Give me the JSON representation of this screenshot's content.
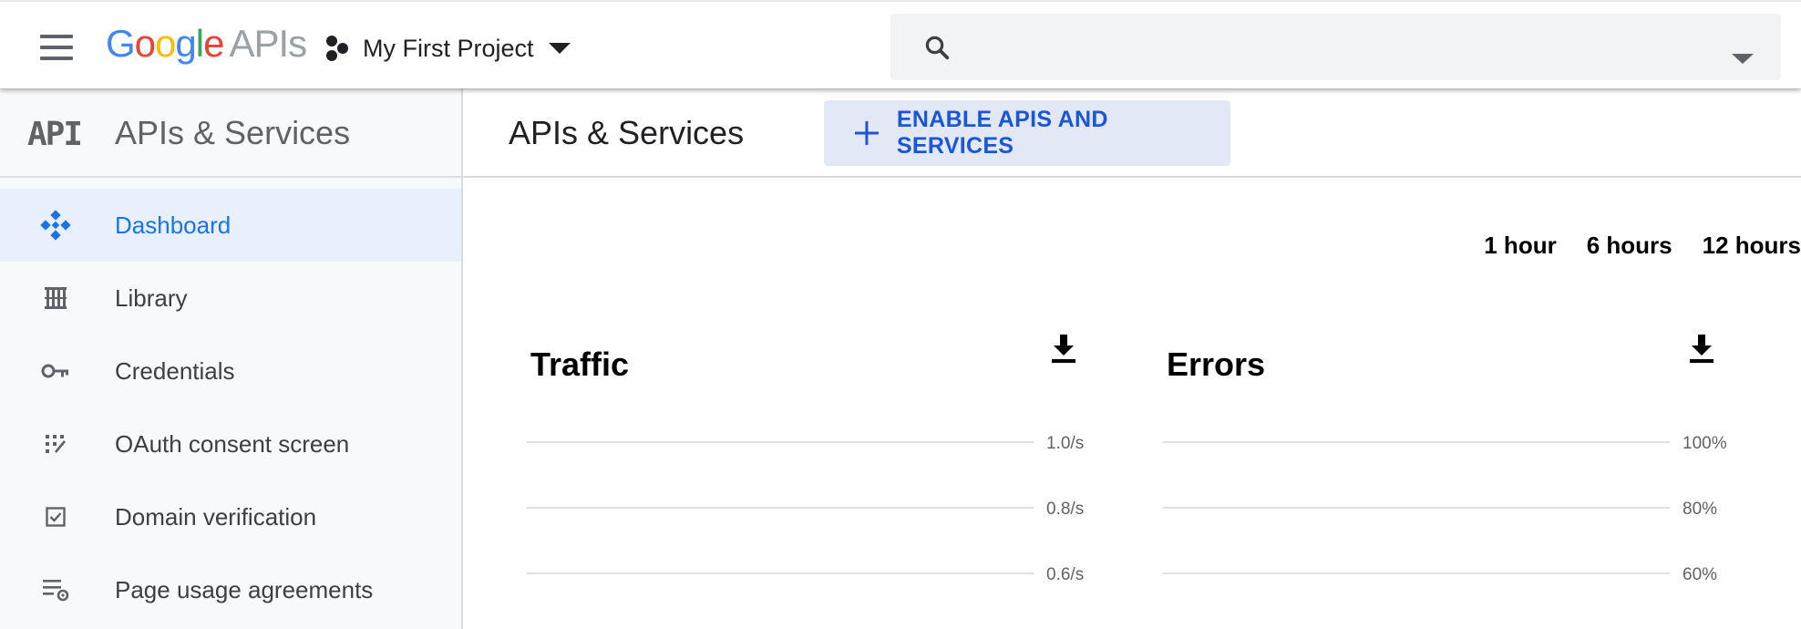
{
  "header": {
    "logo": {
      "google": [
        "G",
        "o",
        "o",
        "g",
        "l",
        "e"
      ],
      "suffix": "APIs",
      "colors": [
        "#4285F4",
        "#EA4335",
        "#FBBC05",
        "#4285F4",
        "#34A853",
        "#EA4335"
      ]
    },
    "project_name": "My First Project",
    "search": {
      "placeholder": "",
      "value": ""
    },
    "icons": {
      "menu": "hamburger-menu-icon",
      "project": "project-hub-icon",
      "search": "search-icon",
      "expand": "chevron-down-icon"
    }
  },
  "sidebar": {
    "logo_text": "API",
    "title": "APIs & Services",
    "items": [
      {
        "label": "Dashboard",
        "icon": "dashboard-icon",
        "active": true
      },
      {
        "label": "Library",
        "icon": "library-icon",
        "active": false
      },
      {
        "label": "Credentials",
        "icon": "key-icon",
        "active": false
      },
      {
        "label": "OAuth consent screen",
        "icon": "oauth-icon",
        "active": false
      },
      {
        "label": "Domain verification",
        "icon": "checkbox-icon",
        "active": false
      },
      {
        "label": "Page usage agreements",
        "icon": "settings-list-icon",
        "active": false
      }
    ]
  },
  "main": {
    "title": "APIs & Services",
    "enable_button": "ENABLE APIS AND SERVICES",
    "time_range": [
      "1 hour",
      "6 hours",
      "12 hours"
    ]
  },
  "colors": {
    "accent": "#1a73e8",
    "active_bg": "#e8f0fe",
    "button_bg": "#e2e8f5"
  },
  "chart_data": [
    {
      "type": "line",
      "title": "Traffic",
      "y_ticks": [
        "1.0/s",
        "0.8/s",
        "0.6/s"
      ],
      "series": [],
      "grid": true
    },
    {
      "type": "line",
      "title": "Errors",
      "y_ticks": [
        "100%",
        "80%",
        "60%"
      ],
      "series": [],
      "grid": true
    }
  ]
}
